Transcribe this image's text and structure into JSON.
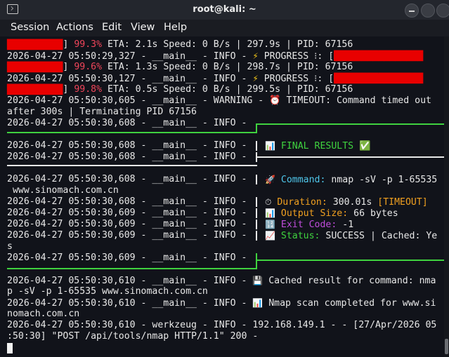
{
  "window": {
    "title": "root@kali: ~"
  },
  "menu": [
    "Session",
    "Actions",
    "Edit",
    "View",
    "Help"
  ],
  "progress": [
    {
      "blocks": "██████████",
      "pct": "99.3%",
      "tail": " ETA: 2.1s Speed: 0 B/s | 297.9s | PID: 67156"
    },
    {
      "prefix": "2026-04-27 05:50:29,327 - __main__ - INFO - ",
      "label": " PROGRESS ⁝: [",
      "bar": "████████████████"
    },
    {
      "blocks": "██████████",
      "pct": "99.6%",
      "tail": " ETA: 1.3s Speed: 0 B/s | 298.7s | PID: 67156"
    },
    {
      "prefix": "2026-04-27 05:50:30,127 - __main__ - INFO - ",
      "label": " PROGRESS ⁝: [",
      "bar": "████████████████"
    },
    {
      "blocks": "██████████",
      "pct": "99.8%",
      "tail": " ETA: 0.5s Speed: 0 B/s | 299.5s | PID: 67156"
    }
  ],
  "warning": {
    "line1": "2026-04-27 05:50:30,605 - __main__ - WARNING - ⏰ TIMEOUT: Command timed out",
    "line2": "after 300s | Terminating PID 67156"
  },
  "log_prefixes": {
    "p608": "2026-04-27 05:50:30,608 - __main__ - INFO - ",
    "p609": "2026-04-27 05:50:30,609 - __main__ - INFO - ",
    "p610": "2026-04-27 05:50:30,610 - __main__ - INFO - "
  },
  "results": {
    "heading": "FINAL RESULTS ✅",
    "command_label": "Command:",
    "command_value": " nmap -sV -p 1-65535",
    "command_wrap": " www.sinomach.com.cn",
    "duration_label": "Duration:",
    "duration_value": " 300.01s ",
    "duration_flag": "[TIMEOUT]",
    "size_label": "Output Size:",
    "size_value": " 66 bytes",
    "exit_label": "Exit Code:",
    "exit_value": " -1",
    "status_label": "Status:",
    "status_value": " SUCCESS | Cached: Ye",
    "status_wrap": "s"
  },
  "tail": {
    "cached1": " Cached result for command: nma",
    "cached2": "p -sV -p 1-65535 www.sinomach.com.cn",
    "scan1": " Nmap scan completed for www.si",
    "scan2": "nomach.com.cn",
    "werk1": "2026-04-27 05:50:30,610 - werkzeug - INFO - 192.168.149.1 - - [27/Apr/2026 05",
    "werk2": ":50:30] \"POST /api/tools/nmap HTTP/1.1\" 200 -"
  },
  "colors": {
    "accent_green": "#3fd23f",
    "progress_red": "#e80000",
    "pct_red": "#f0455a"
  }
}
